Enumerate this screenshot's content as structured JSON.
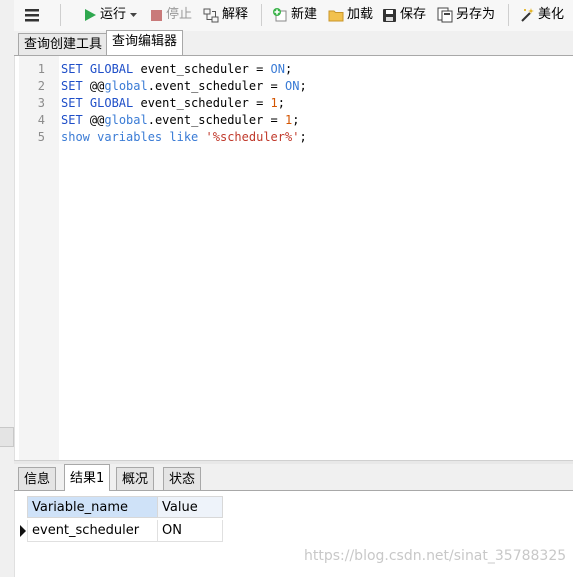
{
  "toolbar": {
    "run_label": "运行",
    "stop_label": "停止",
    "explain_label": "解释",
    "new_label": "新建",
    "load_label": "加载",
    "save_label": "保存",
    "save_as_label": "另存为",
    "beautify_label": "美化"
  },
  "query_tabs": [
    {
      "label": "查询创建工具",
      "active": false
    },
    {
      "label": "查询编辑器",
      "active": true
    }
  ],
  "editor": {
    "lines": [
      {
        "no": "1",
        "segments": [
          {
            "text": "SET GLOBAL",
            "cls": "kw"
          },
          {
            "text": " event_scheduler = ",
            "cls": ""
          },
          {
            "text": "ON",
            "cls": "kw2"
          },
          {
            "text": ";",
            "cls": ""
          }
        ]
      },
      {
        "no": "2",
        "segments": [
          {
            "text": "SET",
            "cls": "kw"
          },
          {
            "text": " @@",
            "cls": ""
          },
          {
            "text": "global",
            "cls": "kw2"
          },
          {
            "text": ".event_scheduler = ",
            "cls": ""
          },
          {
            "text": "ON",
            "cls": "kw2"
          },
          {
            "text": ";",
            "cls": ""
          }
        ]
      },
      {
        "no": "3",
        "segments": [
          {
            "text": "SET GLOBAL",
            "cls": "kw"
          },
          {
            "text": " event_scheduler = ",
            "cls": ""
          },
          {
            "text": "1",
            "cls": "num"
          },
          {
            "text": ";",
            "cls": ""
          }
        ]
      },
      {
        "no": "4",
        "segments": [
          {
            "text": "SET",
            "cls": "kw"
          },
          {
            "text": " @@",
            "cls": ""
          },
          {
            "text": "global",
            "cls": "kw2"
          },
          {
            "text": ".event_scheduler = ",
            "cls": ""
          },
          {
            "text": "1",
            "cls": "num"
          },
          {
            "text": ";",
            "cls": ""
          }
        ]
      },
      {
        "no": "5",
        "segments": [
          {
            "text": "show variables like",
            "cls": "kw2"
          },
          {
            "text": " ",
            "cls": ""
          },
          {
            "text": "'%scheduler%'",
            "cls": "str"
          },
          {
            "text": ";",
            "cls": ""
          }
        ]
      }
    ]
  },
  "result_tabs": [
    {
      "label": "信息",
      "active": false
    },
    {
      "label": "结果1",
      "active": true
    },
    {
      "label": "概况",
      "active": false
    },
    {
      "label": "状态",
      "active": false
    }
  ],
  "result_grid": {
    "columns": [
      "Variable_name",
      "Value"
    ],
    "rows": [
      [
        "event_scheduler",
        "ON"
      ]
    ]
  },
  "watermark": "https://blog.csdn.net/sinat_35788325",
  "icons": {
    "menu": "hamburger-icon",
    "run": "play-icon",
    "stop": "stop-icon",
    "explain": "explain-icon",
    "new": "new-query-icon",
    "load": "folder-icon",
    "save": "save-icon",
    "save_as": "save-as-icon",
    "beautify": "magic-wand-icon",
    "row_indicator": "row-pointer-icon"
  },
  "colors": {
    "keyword": "#1e4ec8",
    "keyword2": "#3a7bd5",
    "string": "#c0392b",
    "number": "#d35400",
    "play": "#2fa84f",
    "stop": "#c97a7a",
    "grid_header_selected": "#cfe2f8"
  }
}
